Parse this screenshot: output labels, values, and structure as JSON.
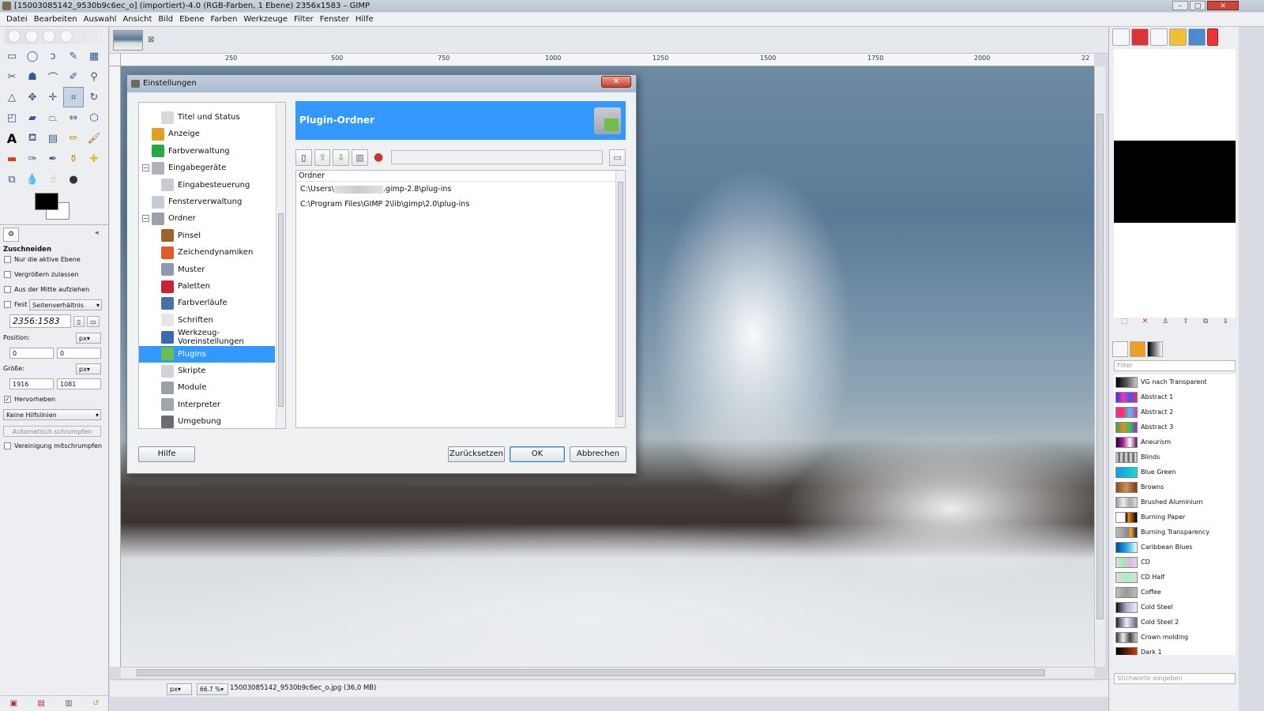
{
  "window": {
    "title": "[15003085142_9530b9c6ec_o] (importiert)-4.0 (RGB-Farben, 1 Ebene) 2356x1583 – GIMP",
    "controls": [
      "–",
      "□",
      "✕"
    ]
  },
  "menu": [
    "Datei",
    "Bearbeiten",
    "Auswahl",
    "Ansicht",
    "Bild",
    "Ebene",
    "Farben",
    "Werkzeuge",
    "Filter",
    "Fenster",
    "Hilfe"
  ],
  "tool_options": {
    "title": "Zuschneiden",
    "only_active_layer": "Nur die aktive Ebene",
    "allow_growing": "Vergrößern zulassen",
    "expand_from_center": "Aus der Mitte aufziehen",
    "fixed_label": "Fest",
    "fixed_value": "Seitenverhältnis",
    "ratio_value": "2356:1583",
    "position_label": "Position:",
    "position_unit": "px",
    "position_x": "0",
    "position_y": "0",
    "size_label": "Größe:",
    "size_unit": "px",
    "size_w": "1916",
    "size_h": "1081",
    "highlight": "Hervorheben",
    "guides": "Keine Hilfslinien",
    "auto_shrink": "Automatisch schrumpfen",
    "shrink_merged": "Vereinigung mitschrumpfen"
  },
  "ruler": {
    "h_ticks": [
      "250",
      "500",
      "750",
      "1000",
      "1250",
      "1500",
      "1750",
      "2000",
      "22"
    ]
  },
  "status": {
    "unit": "px",
    "zoom": "66.7 %",
    "file": "15003085142_9530b9c6ec_o.jpg (36,0 MB)"
  },
  "gradients": {
    "filter_placeholder": "Filter",
    "keyword_placeholder": "Stichworte eingeben",
    "items": [
      {
        "name": "VG nach Transparent",
        "swatch": "linear-gradient(90deg,#000,#555 50%,#ccc)"
      },
      {
        "name": "Abstract 1",
        "swatch": "linear-gradient(90deg,#2233ff,#ff33aa,#4455ff,#ff2266)"
      },
      {
        "name": "Abstract 2",
        "swatch": "linear-gradient(90deg,#ff2299,#ff3366,#33ccff,#ff22aa)"
      },
      {
        "name": "Abstract 3",
        "swatch": "linear-gradient(90deg,#22aa44,#ee8822,#22cc55,#aa22cc)"
      },
      {
        "name": "Aneurism",
        "swatch": "linear-gradient(90deg,#220033,#aa2288,#ffffff,#551166)"
      },
      {
        "name": "Blinds",
        "swatch": "repeating-linear-gradient(90deg,#eee 0,#555 4px,#eee 6px)"
      },
      {
        "name": "Blue Green",
        "swatch": "linear-gradient(90deg,#1199ee,#11ddcc)"
      },
      {
        "name": "Browns",
        "swatch": "linear-gradient(90deg,#8a4a1a,#d29050,#7a3a12)"
      },
      {
        "name": "Brushed Aluminium",
        "swatch": "linear-gradient(90deg,#999,#eee,#aaa,#ddd)"
      },
      {
        "name": "Burning Paper",
        "swatch": "linear-gradient(90deg,#fff 40%,#000 50%,#ff8800 58%,#000)"
      },
      {
        "name": "Burning Transparency",
        "swatch": "linear-gradient(90deg,#bbb,#888 60%,#ffaa22 70%,#222)"
      },
      {
        "name": "Caribbean Blues",
        "swatch": "linear-gradient(90deg,#0044aa,#22aadd,#eeffff)"
      },
      {
        "name": "CD",
        "swatch": "linear-gradient(90deg,#ddd,#99eeaa,#eeaaee,#ddd)"
      },
      {
        "name": "CD Half",
        "swatch": "linear-gradient(90deg,#ddd,#aaeebb,#ddd)"
      },
      {
        "name": "Coffee",
        "swatch": "linear-gradient(90deg,#bbb,#999,#bbb)"
      },
      {
        "name": "Cold Steel",
        "swatch": "linear-gradient(90deg,#111,#aab0cc,#eef)"
      },
      {
        "name": "Cold Steel 2",
        "swatch": "linear-gradient(90deg,#223,#eef,#667)"
      },
      {
        "name": "Crown molding",
        "swatch": "linear-gradient(90deg,#333,#eee,#444,#ccc)"
      },
      {
        "name": "Dark 1",
        "swatch": "linear-gradient(90deg,#000,#552200,#dd3300)"
      }
    ]
  },
  "dialog": {
    "title": "Einstellungen",
    "close": "✕",
    "tree": [
      {
        "label": "Titel und Status",
        "level": 2,
        "color": "#d9d9d9"
      },
      {
        "label": "Anzeige",
        "level": 1,
        "color": "#e0a020"
      },
      {
        "label": "Farbverwaltung",
        "level": 1,
        "color": "#22aa44"
      },
      {
        "label": "Eingabegeräte",
        "level": 1,
        "color": "#b0b4ba",
        "expander": "−"
      },
      {
        "label": "Eingabesteuerung",
        "level": 2,
        "color": "#c8ccd2"
      },
      {
        "label": "Fensterverwaltung",
        "level": 1,
        "color": "#c6ccd6"
      },
      {
        "label": "Ordner",
        "level": 1,
        "color": "#9aa1aa",
        "expander": "−"
      },
      {
        "label": "Pinsel",
        "level": 2,
        "color": "#a0602a"
      },
      {
        "label": "Zeichendynamiken",
        "level": 2,
        "color": "#e05a2a"
      },
      {
        "label": "Muster",
        "level": 2,
        "color": "#8a9ab0"
      },
      {
        "label": "Paletten",
        "level": 2,
        "color": "#cc2233"
      },
      {
        "label": "Farbverläufe",
        "level": 2,
        "color": "#4a70a8"
      },
      {
        "label": "Schriften",
        "level": 2,
        "color": "#e6e6e6"
      },
      {
        "label": "Werkzeug-Voreinstellungen",
        "level": 2,
        "color": "#3a6ab0"
      },
      {
        "label": "Plugins",
        "level": 2,
        "color": "#6cc04a",
        "selected": true
      },
      {
        "label": "Skripte",
        "level": 2,
        "color": "#d0d4da"
      },
      {
        "label": "Module",
        "level": 2,
        "color": "#9aa1aa"
      },
      {
        "label": "Interpreter",
        "level": 2,
        "color": "#a0a6ae"
      },
      {
        "label": "Umgebung",
        "level": 2,
        "color": "#6a6e74"
      }
    ],
    "header": "Plugin-Ordner",
    "list_header": "Ordner",
    "path1_prefix": "C:\\Users\\",
    "path1_suffix": ".gimp-2.8\\plug-ins",
    "path2": "C:\\Program Files\\GIMP 2\\lib\\gimp\\2.0\\plug-ins",
    "help": "Hilfe",
    "reset": "Zurücksetzen",
    "ok": "OK",
    "cancel": "Abbrechen"
  }
}
